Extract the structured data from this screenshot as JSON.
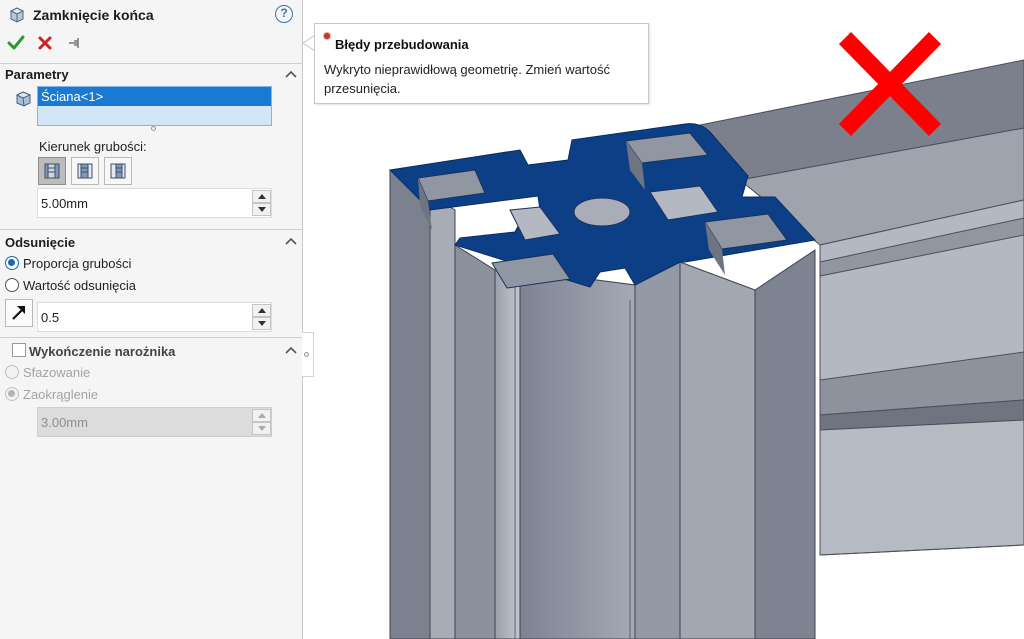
{
  "property_manager": {
    "title": "Zamknięcie końca",
    "help_symbol": "?",
    "icons": {
      "feature": "end-cap-feature-icon",
      "ok": "green-check-icon",
      "cancel": "red-x-icon",
      "pin": "pushpin-icon"
    },
    "colors": {
      "ok": "#2e9a2e",
      "cancel": "#d22020",
      "selection": "#1979d3"
    },
    "parameters": {
      "title": "Parametry",
      "selection_items": [
        "Ściana<1>"
      ],
      "thickness_direction_label": "Kierunek grubości:",
      "direction_buttons": [
        "thickness-outward-icon",
        "thickness-inward-icon",
        "thickness-midplane-icon"
      ],
      "active_direction_index": 0,
      "thickness_value": "5.00mm"
    },
    "offset": {
      "title": "Odsunięcie",
      "options": [
        {
          "label": "Proporcja grubości",
          "checked": true
        },
        {
          "label": "Wartość odsunięcia",
          "checked": false
        }
      ],
      "value": "0.5"
    },
    "corner_treatment": {
      "title": "Wykończenie narożnika",
      "enabled": false,
      "options": [
        {
          "label": "Sfazowanie",
          "checked": false
        },
        {
          "label": "Zaokrąglenie",
          "checked": true
        }
      ],
      "value": "3.00mm"
    }
  },
  "graphics": {
    "error_tooltip": {
      "title": "Błędy przebudowania",
      "message": "Wykryto nieprawidłową geometrię. Zmień wartość przesunięcia."
    },
    "error_mark_icon": "red-x-mark-icon",
    "colors": {
      "error_mark": "#ff0000",
      "selected_face": "#0d3f86",
      "profile": "#8e939f"
    }
  }
}
